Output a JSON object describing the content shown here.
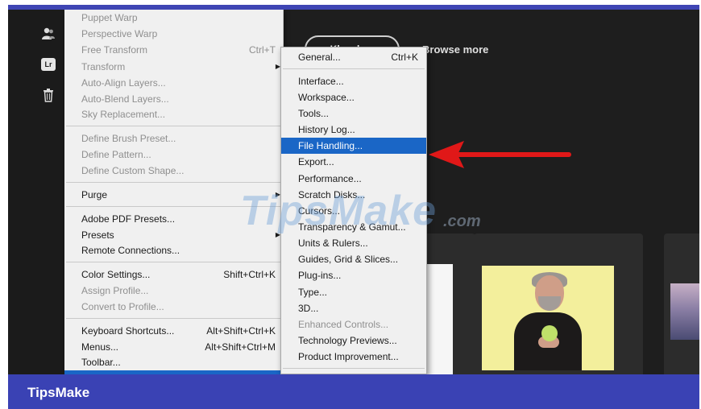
{
  "toolbar": {
    "icons": [
      "people-icon",
      "lightroom-icon",
      "trash-icon"
    ],
    "lr_label": "Lr"
  },
  "home": {
    "button_label": "Khoa học",
    "browse_more": "Browse more"
  },
  "edit_menu": {
    "items": [
      {
        "label": "Puppet Warp",
        "enabled": false
      },
      {
        "label": "Perspective Warp",
        "enabled": false
      },
      {
        "label": "Free Transform",
        "shortcut": "Ctrl+T",
        "enabled": false
      },
      {
        "label": "Transform",
        "enabled": false,
        "submenu": true
      },
      {
        "label": "Auto-Align Layers...",
        "enabled": false
      },
      {
        "label": "Auto-Blend Layers...",
        "enabled": false
      },
      {
        "label": "Sky Replacement...",
        "enabled": false
      },
      {
        "label": "Define Brush Preset...",
        "enabled": false
      },
      {
        "label": "Define Pattern...",
        "enabled": false
      },
      {
        "label": "Define Custom Shape...",
        "enabled": false
      },
      {
        "label": "Purge",
        "enabled": true,
        "submenu": true
      },
      {
        "label": "Adobe PDF Presets...",
        "enabled": true
      },
      {
        "label": "Presets",
        "enabled": true,
        "submenu": true
      },
      {
        "label": "Remote Connections...",
        "enabled": true
      },
      {
        "label": "Color Settings...",
        "shortcut": "Shift+Ctrl+K",
        "enabled": true
      },
      {
        "label": "Assign Profile...",
        "enabled": false
      },
      {
        "label": "Convert to Profile...",
        "enabled": false
      },
      {
        "label": "Keyboard Shortcuts...",
        "shortcut": "Alt+Shift+Ctrl+K",
        "enabled": true
      },
      {
        "label": "Menus...",
        "shortcut": "Alt+Shift+Ctrl+M",
        "enabled": true
      },
      {
        "label": "Toolbar...",
        "enabled": true
      }
    ]
  },
  "preferences_submenu": {
    "items": [
      {
        "label": "General...",
        "shortcut": "Ctrl+K",
        "enabled": true
      },
      {
        "label": "Interface...",
        "enabled": true
      },
      {
        "label": "Workspace...",
        "enabled": true
      },
      {
        "label": "Tools...",
        "enabled": true
      },
      {
        "label": "History Log...",
        "enabled": true
      },
      {
        "label": "File Handling...",
        "enabled": true,
        "highlighted": true
      },
      {
        "label": "Export...",
        "enabled": true
      },
      {
        "label": "Performance...",
        "enabled": true
      },
      {
        "label": "Scratch Disks...",
        "enabled": true
      },
      {
        "label": "Cursors...",
        "enabled": true
      },
      {
        "label": "Transparency & Gamut...",
        "enabled": true
      },
      {
        "label": "Units & Rulers...",
        "enabled": true
      },
      {
        "label": "Guides, Grid & Slices...",
        "enabled": true
      },
      {
        "label": "Plug-ins...",
        "enabled": true
      },
      {
        "label": "Type...",
        "enabled": true
      },
      {
        "label": "3D...",
        "enabled": true
      },
      {
        "label": "Enhanced Controls...",
        "enabled": false
      },
      {
        "label": "Technology Previews...",
        "enabled": true
      },
      {
        "label": "Product Improvement...",
        "enabled": true
      }
    ]
  },
  "watermark": {
    "text": "TipsMake",
    "suffix": ".com"
  },
  "footer": {
    "brand": "TipsMake"
  },
  "colors": {
    "highlight": "#1a66c6",
    "app_bg": "#1e1e1e",
    "footer_bg": "#3a42b4",
    "arrow": "#e01818"
  }
}
